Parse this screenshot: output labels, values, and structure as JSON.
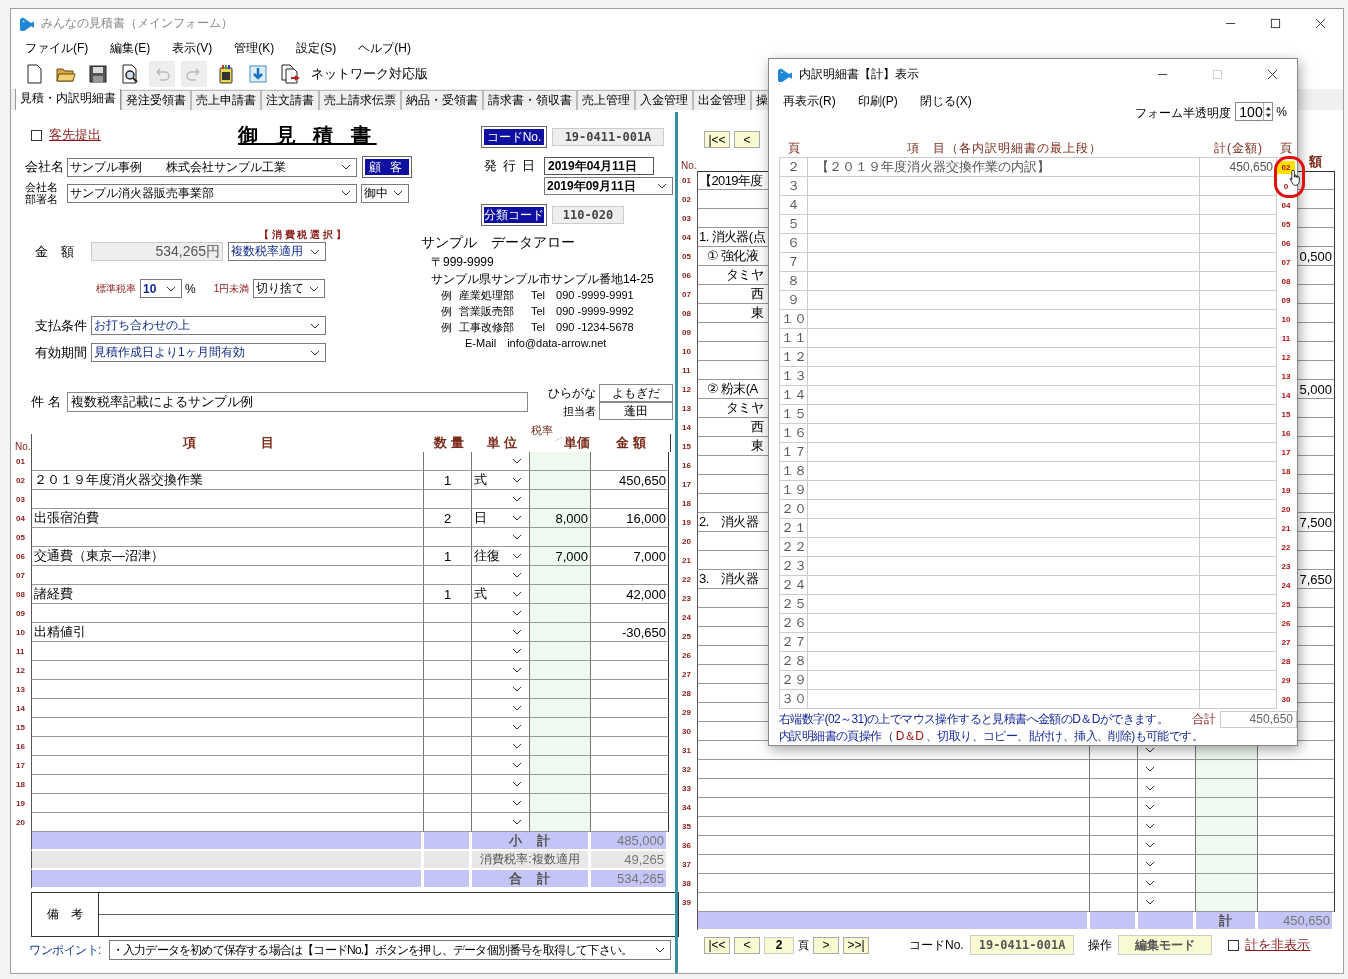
{
  "window": {
    "title": "みんなの見積書（メインフォーム）"
  },
  "menu": [
    "ファイル(F)",
    "編集(E)",
    "表示(V)",
    "管理(K)",
    "設定(S)",
    "ヘルプ(H)"
  ],
  "toolbar": {
    "tools": [
      {
        "kind": "new",
        "disabled": false
      },
      {
        "kind": "open",
        "disabled": false
      },
      {
        "kind": "save",
        "disabled": false
      },
      {
        "kind": "preview",
        "disabled": false
      },
      {
        "kind": "undo",
        "disabled": true
      },
      {
        "kind": "redo",
        "disabled": true
      },
      {
        "kind": "device",
        "disabled": false
      },
      {
        "kind": "download",
        "disabled": false
      },
      {
        "kind": "export",
        "disabled": false
      }
    ],
    "edition": "ネットワーク対応版"
  },
  "tabs": [
    {
      "label": "見積・内訳明細書",
      "selected": true
    },
    {
      "label": "発注受領書",
      "selected": false
    },
    {
      "label": "売上申請書",
      "selected": false
    },
    {
      "label": "注文請書",
      "selected": false
    },
    {
      "label": "売上請求伝票",
      "selected": false
    },
    {
      "label": "納品・受領書",
      "selected": false
    },
    {
      "label": "請求書・領収書",
      "selected": false
    },
    {
      "label": "売上管理",
      "selected": false
    },
    {
      "label": "入金管理",
      "selected": false
    },
    {
      "label": "出金管理",
      "selected": false
    },
    {
      "label": "操",
      "selected": false
    }
  ],
  "estimate": {
    "submit": {
      "label": "客先提出",
      "checked": false
    },
    "title": "御 見 積 書",
    "code_button": "コードNo.",
    "code": "19-0411-001A",
    "company_label": "会社名",
    "company": "サンプル事例　　株式会社サンプル工業",
    "customer_button": "顧 客",
    "dept_label": [
      "会社名",
      "部署名"
    ],
    "dept": "サンプル消火器販売事業部",
    "honorific": "御中",
    "issue_label": "発 行 日",
    "issue_date": "2019年04月11日",
    "valid_date": "2019年09月11日",
    "class_button": "分類コード",
    "class_code": "110-020",
    "tax_select_label": "【 消 費 税 選 択 】",
    "amount_label": "金　額",
    "amount": "534,265円",
    "tax_mode": "複数税率適用",
    "std_rate_label": "標準税率",
    "std_rate": "10",
    "percent": "%",
    "rounding_label": "1円未満",
    "rounding": "切り捨て",
    "payment_label": "支払条件",
    "payment": "お打ち合わせの上",
    "validity_label": "有効期間",
    "validity": "見積作成日より1ヶ月間有効",
    "subject_label": "件 名",
    "subject": "複数税率記載によるサンプル例"
  },
  "issuer": {
    "name": "サンプル　データアロー",
    "postal": "〒999-9999",
    "address": "サンプル県サンプル市サンプル番地14-25",
    "departments": [
      {
        "prefix": "例",
        "name": "産業処理部",
        "tel": "Tel　090 -9999-9991"
      },
      {
        "prefix": "例",
        "name": "営業販売部",
        "tel": "Tel　090 -9999-9992"
      },
      {
        "prefix": "例",
        "name": "工事改修部",
        "tel": "Tel　090 -1234-5678"
      }
    ],
    "email": "E-Mail　info@data-arrow.net"
  },
  "staff": {
    "kana_label": "ひらがな",
    "kana": "よもぎだ",
    "label": "担当者",
    "name": "蓬田"
  },
  "items_table": {
    "columns": {
      "no": "No.",
      "item": "項　　　　　目",
      "qty": "数 量",
      "unit": "単 位",
      "rate": "税率",
      "price": "単価",
      "amount": "金 額"
    },
    "rows": [
      {
        "no": "01"
      },
      {
        "no": "02",
        "item": "２０１９年度消火器交換作業",
        "qty": "1",
        "unit": "式",
        "amount": "450,650"
      },
      {
        "no": "03"
      },
      {
        "no": "04",
        "item": "出張宿泊費",
        "qty": "2",
        "unit": "日",
        "price": "8,000",
        "amount": "16,000"
      },
      {
        "no": "05"
      },
      {
        "no": "06",
        "item": "交通費（東京―沼津）",
        "qty": "1",
        "unit": "往復",
        "price": "7,000",
        "amount": "7,000"
      },
      {
        "no": "07"
      },
      {
        "no": "08",
        "item": "諸経費",
        "qty": "1",
        "unit": "式",
        "amount": "42,000"
      },
      {
        "no": "09"
      },
      {
        "no": "10",
        "item": "出精値引",
        "amount": "-30,650"
      },
      {
        "no": "11"
      },
      {
        "no": "12"
      },
      {
        "no": "13"
      },
      {
        "no": "14"
      },
      {
        "no": "15"
      },
      {
        "no": "16"
      },
      {
        "no": "17"
      },
      {
        "no": "18"
      },
      {
        "no": "19"
      },
      {
        "no": "20"
      }
    ],
    "totals": [
      {
        "kind": "subtotal",
        "label": "小　計",
        "value": "485,000"
      },
      {
        "kind": "tax",
        "label": "消費税率:複数適用",
        "value": "49,265"
      },
      {
        "kind": "total",
        "label": "合　計",
        "value": "534,265"
      }
    ]
  },
  "remarks": {
    "label": "備　考"
  },
  "tip": {
    "label": "ワンポイント:",
    "text": "・入力データを初めて保存する場合は【コードNo.】ボタンを押し、データ個別番号を取得して下さい。"
  },
  "detail": {
    "nav_top": [
      "|<<",
      "<"
    ],
    "columns": {
      "no": "No.",
      "amount": "額"
    },
    "rows": [
      {
        "no": "01",
        "kind": "heading",
        "item": "【2019年度"
      },
      {
        "no": "02"
      },
      {
        "no": "03"
      },
      {
        "no": "04",
        "kind": "heading",
        "item": "1. 消火器(点"
      },
      {
        "no": "05",
        "kind": "sub",
        "item": "① 強化液",
        "amount": "0,500"
      },
      {
        "no": "06",
        "kind": "detail",
        "item": "タミヤ"
      },
      {
        "no": "07",
        "kind": "detail",
        "item": "西"
      },
      {
        "no": "08",
        "kind": "detail",
        "item": "東"
      },
      {
        "no": "09"
      },
      {
        "no": "10"
      },
      {
        "no": "11"
      },
      {
        "no": "12",
        "kind": "sub",
        "item": "② 粉末(A",
        "amount": "5,000"
      },
      {
        "no": "13",
        "kind": "detail",
        "item": "タミヤ"
      },
      {
        "no": "14",
        "kind": "detail",
        "item": "西"
      },
      {
        "no": "15",
        "kind": "detail",
        "item": "東"
      },
      {
        "no": "16"
      },
      {
        "no": "17"
      },
      {
        "no": "18"
      },
      {
        "no": "19",
        "kind": "heading",
        "item": "2.　消火器",
        "amount": "7,500"
      },
      {
        "no": "20"
      },
      {
        "no": "21"
      },
      {
        "no": "22",
        "kind": "heading",
        "item": "3.　消火器",
        "amount": "7,650"
      },
      {
        "no": "23"
      },
      {
        "no": "24"
      },
      {
        "no": "25"
      },
      {
        "no": "26"
      },
      {
        "no": "27"
      },
      {
        "no": "28"
      },
      {
        "no": "29"
      },
      {
        "no": "30"
      },
      {
        "no": "31"
      },
      {
        "no": "32"
      },
      {
        "no": "33"
      },
      {
        "no": "34"
      },
      {
        "no": "35"
      },
      {
        "no": "36"
      },
      {
        "no": "37"
      },
      {
        "no": "38"
      },
      {
        "no": "39"
      }
    ],
    "total_label": "計",
    "total": "450,650",
    "nav_bottom": {
      "first": "|<<",
      "prev": "<",
      "page": "2",
      "page_unit": "頁",
      "next": ">",
      "last": ">>|"
    },
    "code_label": "コードNo.",
    "code": "19-0411-001A",
    "mode_label": "操作",
    "mode": "編集モード",
    "hide_total": {
      "label": "計を非表示",
      "checked": false
    }
  },
  "dialog": {
    "title": "内訳明細書【計】表示",
    "menu": [
      "再表示(R)",
      "印刷(P)",
      "閉じる(X)"
    ],
    "opacity_label": "フォーム半透明度",
    "opacity": "100",
    "percent": "%",
    "columns": {
      "page": "頁",
      "item": "項　目（各内訳明細書の最上段）",
      "amount": "計(金額)",
      "link": "頁"
    },
    "rows": [
      {
        "page": "２",
        "item": "【２０１９年度消火器交換作業の内訳】",
        "amount": "450,650",
        "link": "02",
        "selected": true
      },
      {
        "page": "３",
        "link": "0",
        "selected": false
      },
      {
        "page": "４",
        "link": "04",
        "selected": false
      },
      {
        "page": "５",
        "link": "05",
        "selected": false
      },
      {
        "page": "６",
        "link": "06",
        "selected": false
      },
      {
        "page": "７",
        "link": "07",
        "selected": false
      },
      {
        "page": "８",
        "link": "08",
        "selected": false
      },
      {
        "page": "９",
        "link": "09",
        "selected": false
      },
      {
        "page": "１０",
        "link": "10",
        "selected": false
      },
      {
        "page": "１１",
        "link": "11",
        "selected": false
      },
      {
        "page": "１２",
        "link": "12",
        "selected": false
      },
      {
        "page": "１３",
        "link": "13",
        "selected": false
      },
      {
        "page": "１４",
        "link": "14",
        "selected": false
      },
      {
        "page": "１５",
        "link": "15",
        "selected": false
      },
      {
        "page": "１６",
        "link": "16",
        "selected": false
      },
      {
        "page": "１７",
        "link": "17",
        "selected": false
      },
      {
        "page": "１８",
        "link": "18",
        "selected": false
      },
      {
        "page": "１９",
        "link": "19",
        "selected": false
      },
      {
        "page": "２０",
        "link": "20",
        "selected": false
      },
      {
        "page": "２１",
        "link": "21",
        "selected": false
      },
      {
        "page": "２２",
        "link": "22",
        "selected": false
      },
      {
        "page": "２３",
        "link": "23",
        "selected": false
      },
      {
        "page": "２４",
        "link": "24",
        "selected": false
      },
      {
        "page": "２５",
        "link": "25",
        "selected": false
      },
      {
        "page": "２６",
        "link": "26",
        "selected": false
      },
      {
        "page": "２７",
        "link": "27",
        "selected": false
      },
      {
        "page": "２８",
        "link": "28",
        "selected": false
      },
      {
        "page": "２９",
        "link": "29",
        "selected": false
      },
      {
        "page": "３０",
        "link": "30",
        "selected": false
      }
    ],
    "note": "右端数字(02～31)の上でマウス操作すると見積書へ金額のD＆Dができます。",
    "total_label": "合計",
    "total": "450,650",
    "note2": "内訳明細書の頁操作（ **D＆D** 、切取り、コピー、貼付け、挿入、削除)も可能です。"
  }
}
